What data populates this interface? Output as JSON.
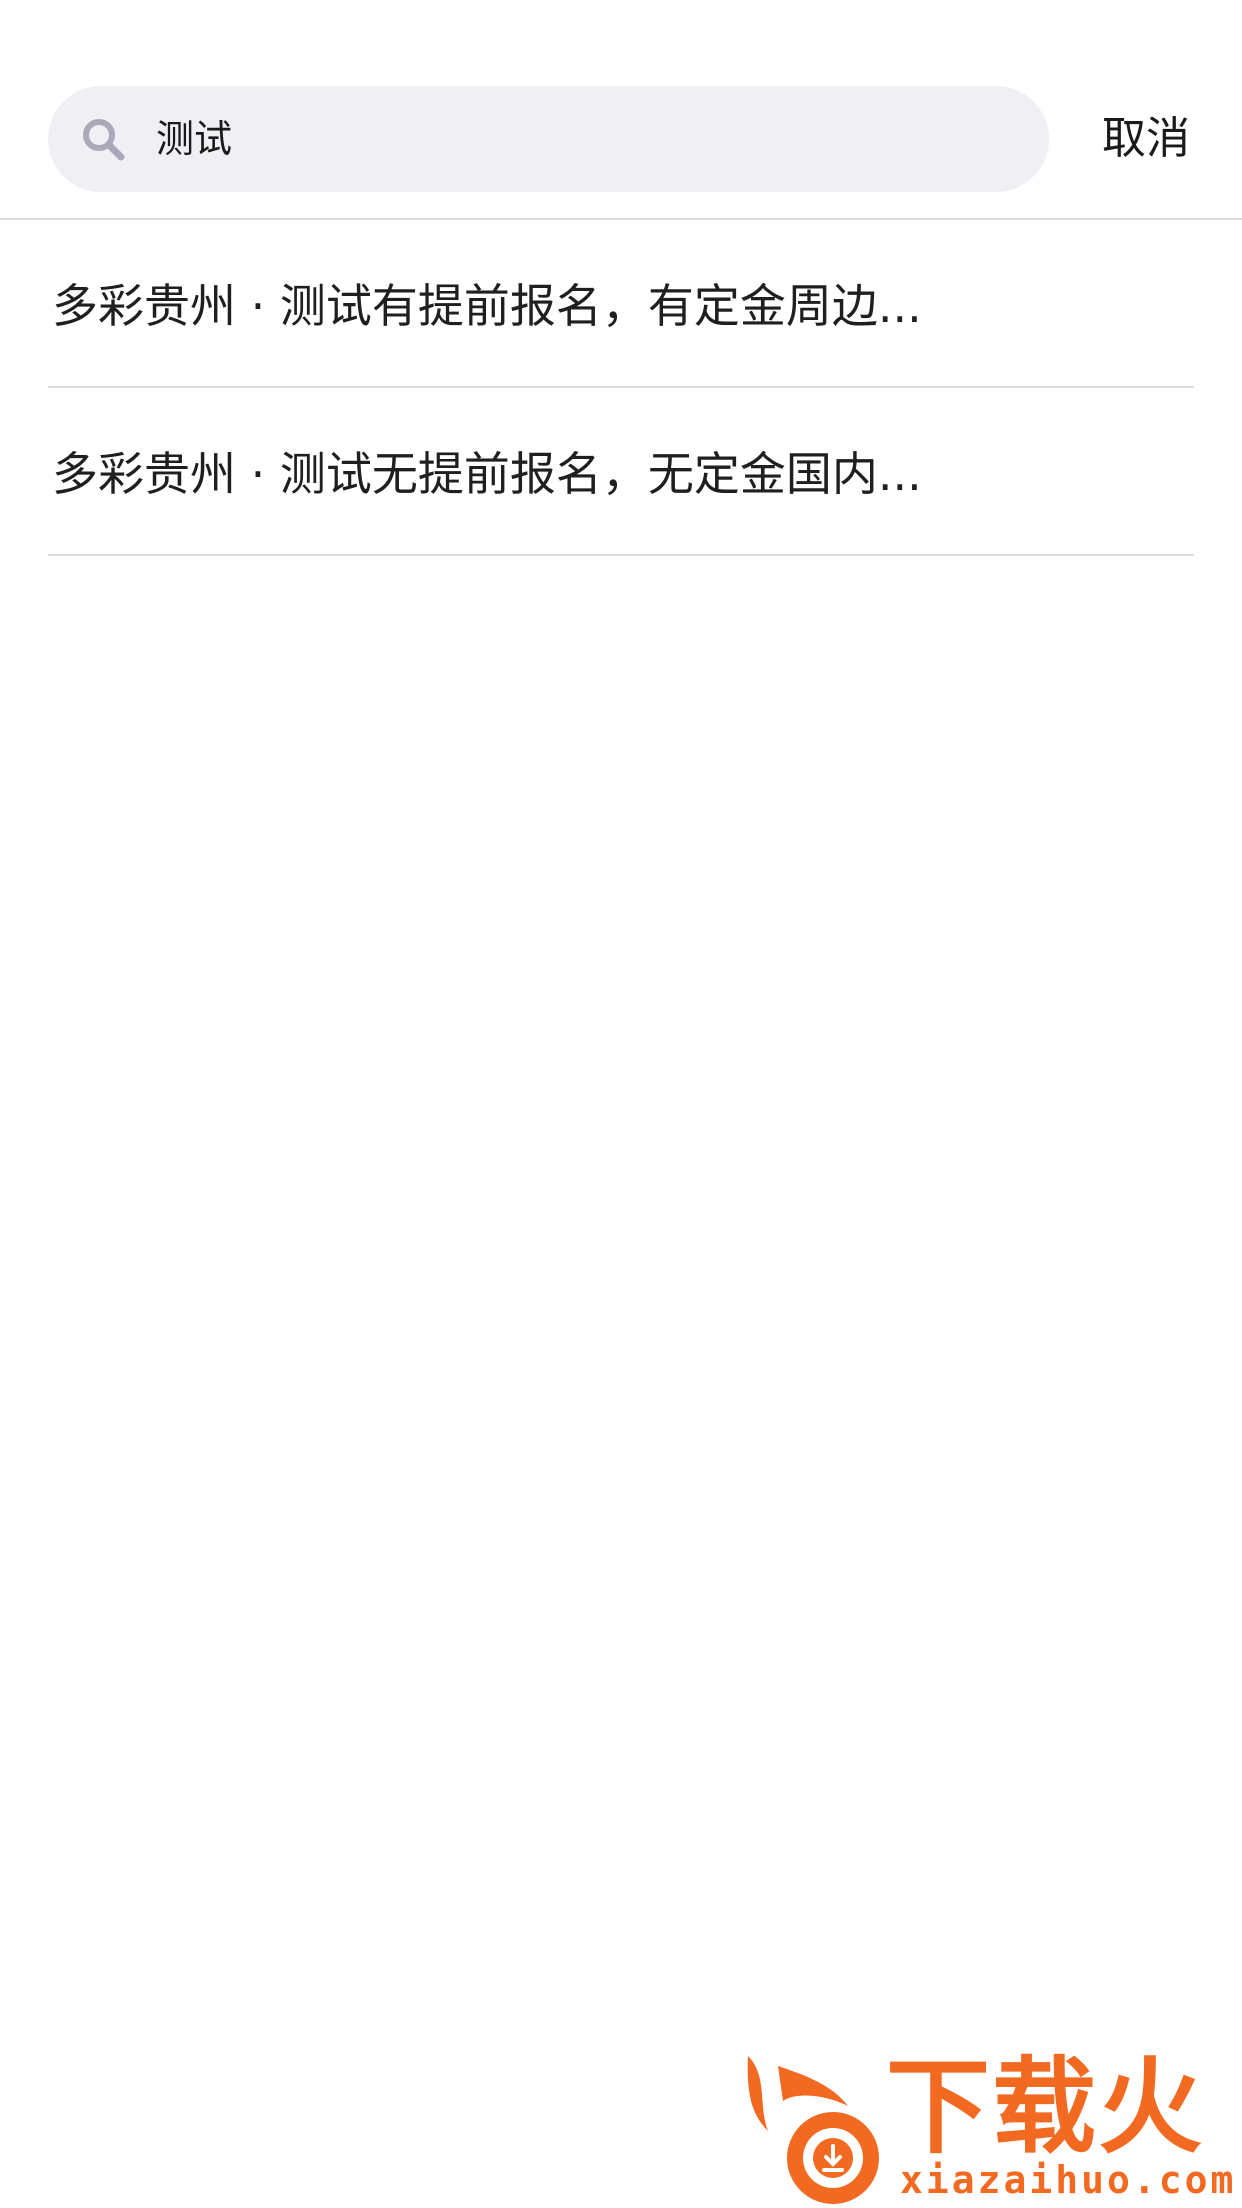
{
  "search": {
    "value": "测试",
    "icon": "search-icon",
    "cancel_label": "取消"
  },
  "results": [
    {
      "text": "多彩贵州 · 测试有提前报名，有定金周边..."
    },
    {
      "text": "多彩贵州 · 测试无提前报名，无定金国内..."
    }
  ],
  "watermark": {
    "brand": "下载火",
    "url": "xiazaihuo.com",
    "color": "#f26a22"
  }
}
